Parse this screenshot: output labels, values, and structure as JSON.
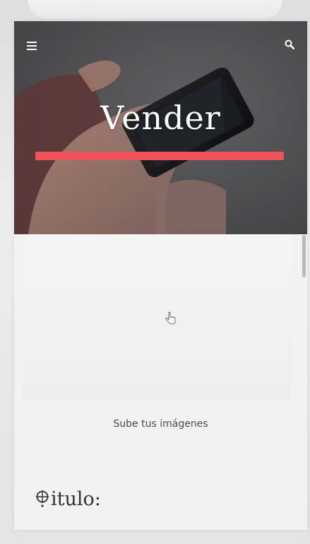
{
  "header": {
    "menu_icon": "hamburger-icon",
    "search_icon": "search-icon"
  },
  "hero": {
    "title": "Vender",
    "accent_color": "#f0525c"
  },
  "upload": {
    "label": "Sube tus imágenes",
    "cursor_icon": "hand-pointer-icon"
  },
  "form": {
    "title_label": "itulo:",
    "title_icon": "crosshair-target-icon"
  },
  "colors": {
    "hero_background": "#5b5b5d",
    "page_background": "#f2f2f2"
  }
}
